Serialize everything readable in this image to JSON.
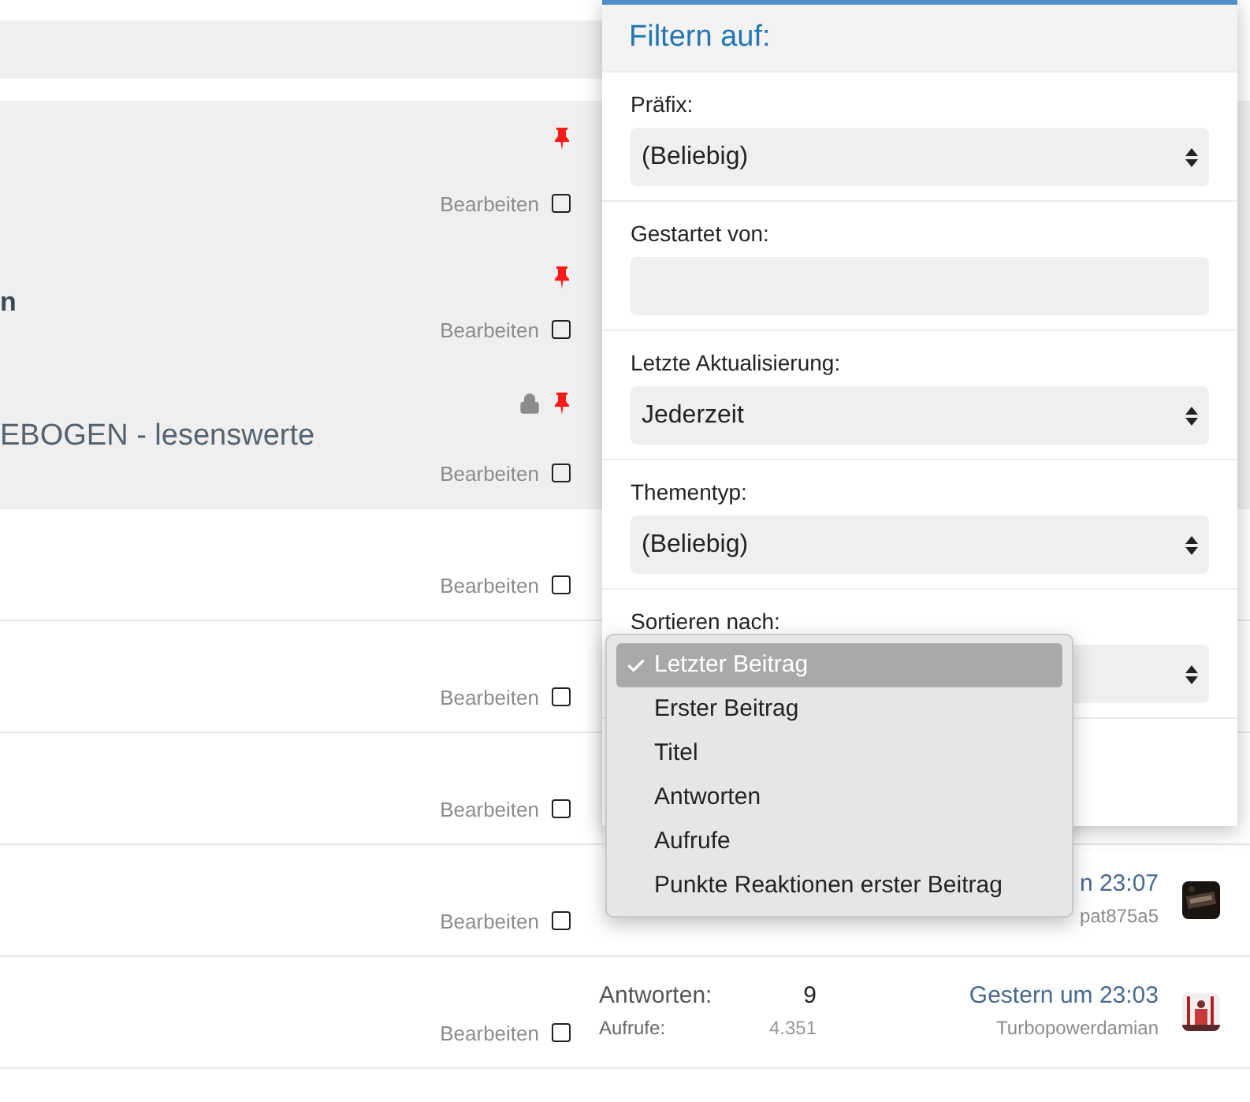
{
  "threads": [
    {
      "sticky": true,
      "pinned": true,
      "locked": false,
      "edit_label": "Bearbeiten",
      "checked": false
    },
    {
      "sticky": true,
      "title": "n",
      "unread": true,
      "pinned": true,
      "locked": false,
      "edit_label": "Bearbeiten",
      "checked": false
    },
    {
      "sticky": true,
      "title": "EBOGEN - lesenswerte",
      "unread": false,
      "pinned": true,
      "locked": true,
      "edit_label": "Bearbeiten",
      "checked": false
    },
    {
      "sticky": false,
      "pinned": false,
      "locked": false,
      "edit_label": "Bearbeiten",
      "checked": false
    },
    {
      "sticky": false,
      "pinned": false,
      "locked": false,
      "edit_label": "Bearbeiten",
      "checked": false
    },
    {
      "sticky": false,
      "pinned": false,
      "locked": false,
      "edit_label": "Bearbeiten",
      "checked": false
    },
    {
      "sticky": false,
      "pinned": false,
      "locked": false,
      "edit_label": "Bearbeiten",
      "checked": false,
      "last_post": "n 23:07",
      "last_user": "pat875a5"
    },
    {
      "sticky": false,
      "pinned": false,
      "locked": false,
      "edit_label": "Bearbeiten",
      "checked": false,
      "replies_label": "Antworten:",
      "replies": "9",
      "views_label": "Aufrufe:",
      "views": "4.351",
      "last_post": "Gestern um 23:03",
      "last_user": "Turbopowerdamian"
    }
  ],
  "filter_panel": {
    "title": "Filtern auf:",
    "fields": [
      {
        "kind": "select",
        "label": "Präfix:",
        "value": "(Beliebig)"
      },
      {
        "kind": "text",
        "label": "Gestartet von:"
      },
      {
        "kind": "select",
        "label": "Letzte Aktualisierung:",
        "value": "Jederzeit"
      },
      {
        "kind": "select",
        "label": "Thementyp:",
        "value": "(Beliebig)"
      },
      {
        "kind": "select",
        "label": "Sortieren nach:"
      }
    ]
  },
  "sort_menu": {
    "options": [
      {
        "label": "Letzter Beitrag",
        "selected": true
      },
      {
        "label": "Erster Beitrag",
        "selected": false
      },
      {
        "label": "Titel",
        "selected": false
      },
      {
        "label": "Antworten",
        "selected": false
      },
      {
        "label": "Aufrufe",
        "selected": false
      },
      {
        "label": "Punkte Reaktionen erster Beitrag",
        "selected": false
      }
    ]
  }
}
